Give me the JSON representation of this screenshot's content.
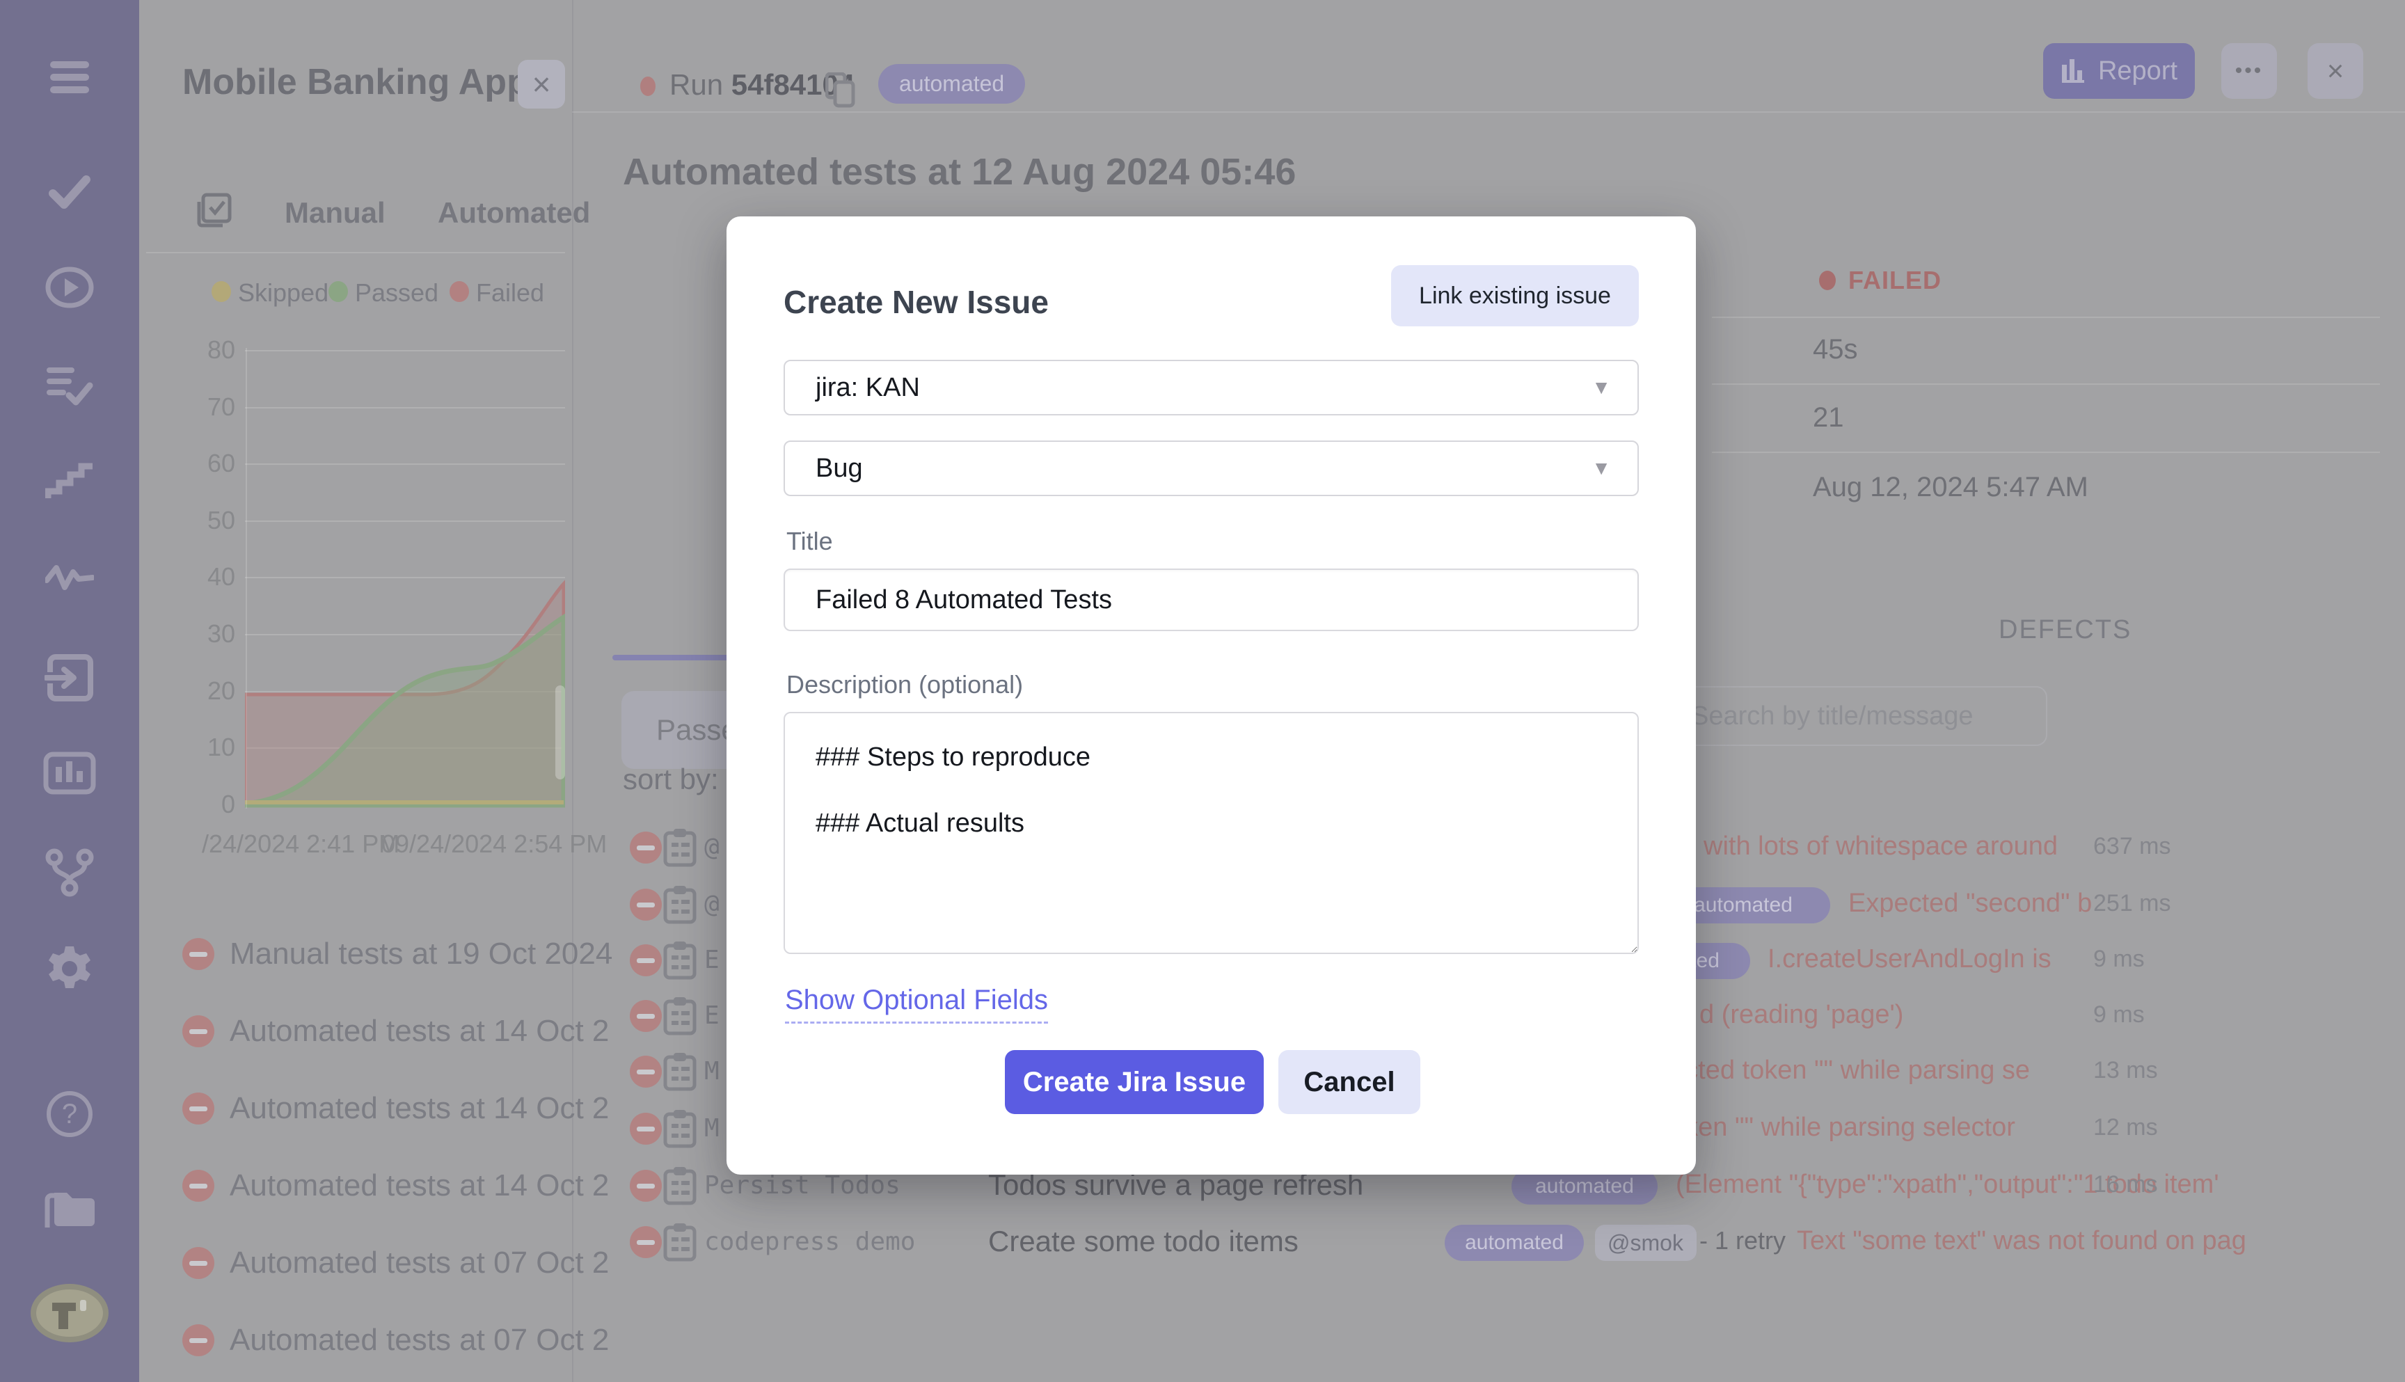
{
  "sidebar": {
    "icons": [
      {
        "name": "menu"
      },
      {
        "name": "check"
      },
      {
        "name": "play"
      },
      {
        "name": "task-list"
      },
      {
        "name": "steps"
      },
      {
        "name": "activity"
      },
      {
        "name": "sign-in"
      },
      {
        "name": "analytics"
      },
      {
        "name": "branch"
      },
      {
        "name": "settings"
      },
      {
        "name": "help"
      },
      {
        "name": "projects"
      },
      {
        "name": "logo",
        "label": "T"
      }
    ]
  },
  "project_panel": {
    "title": "Mobile Banking App",
    "close_label": "×",
    "tabs": {
      "manual": "Manual",
      "automated": "Automated"
    },
    "legend": [
      {
        "label": "Skipped",
        "color": "#b3a878"
      },
      {
        "label": "Passed",
        "color": "#8ba584"
      },
      {
        "label": "Failed",
        "color": "#b28181"
      }
    ],
    "y_ticks": [
      "80",
      "70",
      "60",
      "50",
      "40",
      "30",
      "20",
      "10",
      "0"
    ],
    "x_ticks": [
      "/24/2024 2:41 PM",
      "09/24/2024 2:54 PM"
    ],
    "runs": [
      {
        "label": "Manual tests at 19 Oct 2024"
      },
      {
        "label": "Automated tests at 14 Oct 2"
      },
      {
        "label": "Automated tests at 14 Oct 2"
      },
      {
        "label": "Automated tests at 14 Oct 2"
      },
      {
        "label": "Automated tests at 07 Oct 2"
      },
      {
        "label": "Automated tests at 07 Oct 2"
      }
    ]
  },
  "chart_data": {
    "type": "area",
    "title": "",
    "xlabel": "",
    "ylabel": "",
    "x_range": [
      "09/24/2024 2:41 PM",
      "09/24/2024 2:54 PM"
    ],
    "ylim": [
      0,
      80
    ],
    "grid": true,
    "legend_position": "top",
    "series": [
      {
        "name": "Skipped",
        "color": "#b3ab7a",
        "values": [
          0,
          0,
          0,
          0,
          0,
          0,
          0,
          0,
          0
        ]
      },
      {
        "name": "Passed",
        "color": "#8ba584",
        "values": [
          0,
          2,
          7,
          13,
          17,
          19,
          20,
          25,
          33
        ]
      },
      {
        "name": "Failed",
        "color": "#b07f7f",
        "values": [
          20,
          20,
          20,
          20,
          20,
          20,
          22,
          30,
          39
        ]
      }
    ]
  },
  "run_header": {
    "label": "Run",
    "run_id": "54f84104",
    "badge": "automated",
    "report_label": "Report",
    "more_label": "•••",
    "close_label": "×"
  },
  "run_view": {
    "heading": "Automated tests at 12 Aug 2024 05:46",
    "status": "FAILED",
    "duration": "45s",
    "tests_count": "21",
    "started": "Aug 12, 2024 5:47 AM",
    "defects_title": "DEFECTS",
    "search_placeholder": "Search by title/message",
    "passed_filter": "Passed",
    "sort_label": "sort by:"
  },
  "test_rows": [
    {
      "suite": "@",
      "error": "with lots of whitespace around",
      "duration": "637 ms"
    },
    {
      "suite": "@",
      "tag": "automated",
      "error": "Expected \"second\" b",
      "duration": "251 ms"
    },
    {
      "suite": "E",
      "tag": "automated",
      "error": "I.createUserAndLogIn is",
      "duration": "9 ms"
    },
    {
      "suite": "E",
      "error": "d (reading 'page')",
      "duration": "9 ms"
    },
    {
      "suite": "M",
      "error": "ected token \"\" while parsing se",
      "duration": "13 ms"
    },
    {
      "suite": "M",
      "error": "oken \"\" while parsing selector",
      "duration": "12 ms"
    },
    {
      "suite": "Persist Todos",
      "title": "Todos survive a page refresh",
      "tag": "automated",
      "error": "(Element \"{\"type\":\"xpath\",\"output\":\"1 todo item'",
      "duration": "16 ms"
    },
    {
      "suite": "codepress demo",
      "title": "Create some todo items",
      "tag": "automated",
      "tag2": "@smok",
      "retry": "- 1 retry",
      "error": "Text \"some text\" was not found on pag",
      "duration": ""
    }
  ],
  "modal": {
    "title": "Create New Issue",
    "link_existing_label": "Link existing issue",
    "project_select_value": "jira: KAN",
    "type_select_value": "Bug",
    "title_label": "Title",
    "title_value": "Failed 8 Automated Tests",
    "description_label": "Description (optional)",
    "description_value": "### Steps to reproduce\n\n### Actual results",
    "optional_fields_label": "Show Optional Fields",
    "submit_label": "Create Jira Issue",
    "cancel_label": "Cancel",
    "accent_color": "#5b5ce2"
  }
}
